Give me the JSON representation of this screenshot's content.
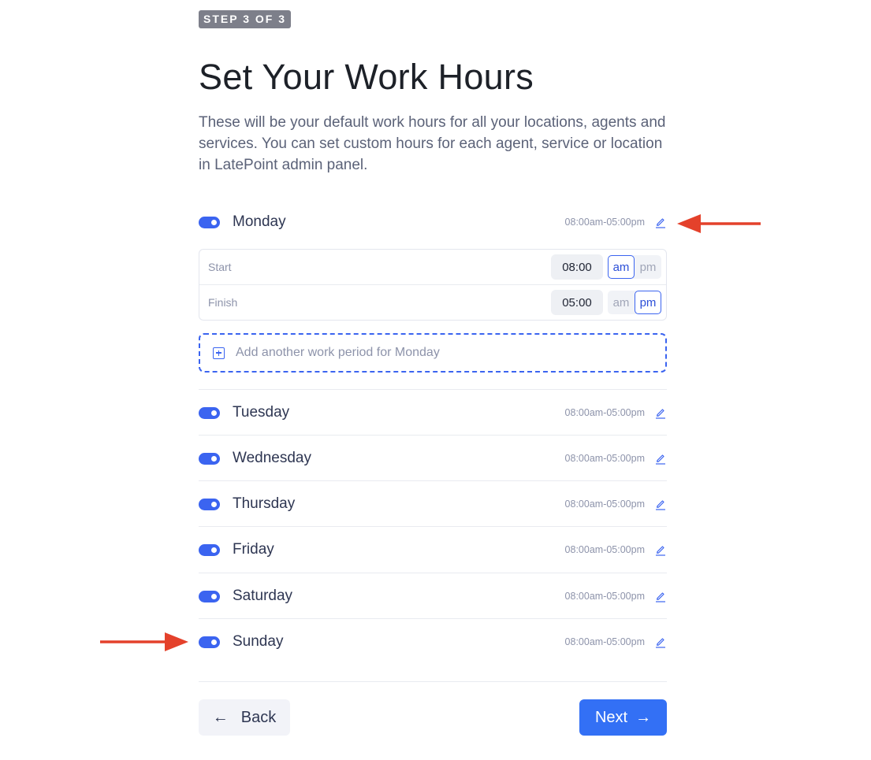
{
  "step_badge": "STEP 3 OF 3",
  "title": "Set Your Work Hours",
  "description": "These will be your default work hours for all your locations, agents and services. You can set custom hours for each agent, service or location in LatePoint admin panel.",
  "days": [
    {
      "name": "Monday",
      "enabled": true,
      "hours": "08:00am-05:00pm",
      "expanded": true
    },
    {
      "name": "Tuesday",
      "enabled": true,
      "hours": "08:00am-05:00pm"
    },
    {
      "name": "Wednesday",
      "enabled": true,
      "hours": "08:00am-05:00pm"
    },
    {
      "name": "Thursday",
      "enabled": true,
      "hours": "08:00am-05:00pm"
    },
    {
      "name": "Friday",
      "enabled": true,
      "hours": "08:00am-05:00pm"
    },
    {
      "name": "Saturday",
      "enabled": true,
      "hours": "08:00am-05:00pm"
    },
    {
      "name": "Sunday",
      "enabled": true,
      "hours": "08:00am-05:00pm"
    }
  ],
  "period": {
    "start": {
      "label": "Start",
      "time": "08:00",
      "am": "am",
      "pm": "pm",
      "selected": "am"
    },
    "finish": {
      "label": "Finish",
      "time": "05:00",
      "am": "am",
      "pm": "pm",
      "selected": "pm"
    }
  },
  "add_period_label": "Add another work period for Monday",
  "buttons": {
    "back": "Back",
    "next": "Next",
    "back_arrow": "←",
    "next_arrow": "→"
  },
  "colors": {
    "accent": "#3b64f0",
    "next_button": "#3370f5",
    "annotation_arrow": "#e4412b"
  }
}
